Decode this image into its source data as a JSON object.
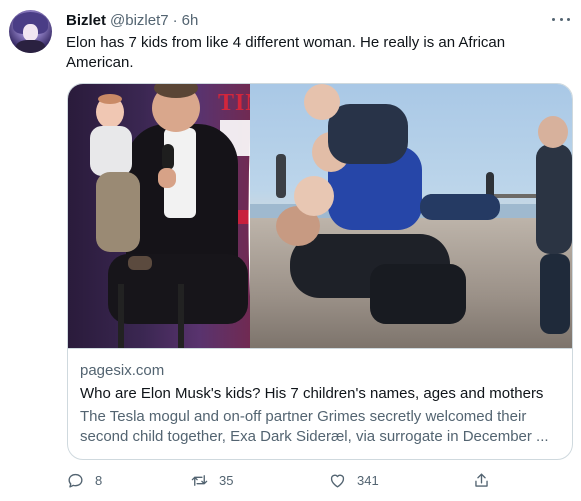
{
  "tweet": {
    "author_name": "Bizlet",
    "author_handle": "@bizlet7",
    "separator": "·",
    "time": "6h",
    "text": "Elon has 7 kids from like 4 different woman. He really is an African American."
  },
  "link_card": {
    "domain": "pagesix.com",
    "title": "Who are Elon Musk's kids? His 7 children's names, ages and mothers",
    "description": "The Tesla mogul and on-off partner Grimes secretly welcomed their second child together, Exa Dark Sideræl, via surrogate in December ...",
    "image_left_overlay_text": "TIM"
  },
  "actions": {
    "reply_count": "8",
    "retweet_count": "35",
    "like_count": "341"
  },
  "icons": {
    "more": "more-icon",
    "reply": "reply-icon",
    "retweet": "retweet-icon",
    "like": "heart-icon",
    "share": "share-icon"
  },
  "colors": {
    "text_primary": "#0f1419",
    "text_secondary": "#536471",
    "border": "#cfd9de"
  }
}
